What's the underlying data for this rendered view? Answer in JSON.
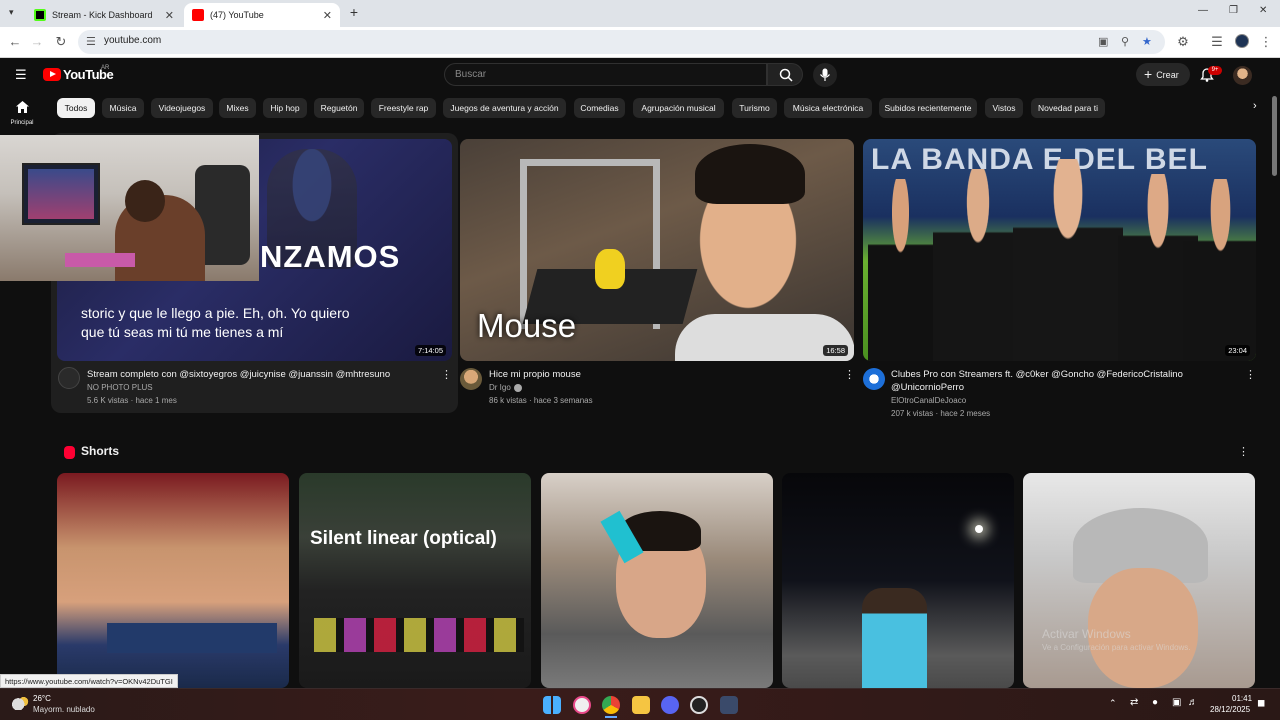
{
  "browser": {
    "tabs": [
      {
        "title": "Stream - Kick Dashboard",
        "active": false,
        "favicon_color": "#53fc18"
      },
      {
        "title": "(47) YouTube",
        "active": true,
        "favicon_color": "#ff0000"
      }
    ],
    "new_tab": "+",
    "url": "youtube.com"
  },
  "yt": {
    "logo_text": "YouTube",
    "country": "AR",
    "search_placeholder": "Buscar",
    "create_label": "Crear",
    "notif_count": "9+",
    "home_label": "Principal",
    "chips": [
      "Todos",
      "Música",
      "Videojuegos",
      "Mixes",
      "Hip hop",
      "Reguetón",
      "Freestyle rap",
      "Juegos de aventura y acción",
      "Comedias",
      "Agrupación musical",
      "Turismo",
      "Música electrónica",
      "Subidos recientemente",
      "Vistos",
      "Novedad para ti"
    ],
    "videos": [
      {
        "title": "Stream completo con @sixtoyegros @juicynise @juanssin @mhtresuno",
        "channel": "NO PHOTO PLUS",
        "meta": "5.6 K vistas · hace 1 mes",
        "duration": "7:14:05",
        "overlay_big": "NZAMOS",
        "overlay_caption": "storic y que le llego a pie. Eh, oh. Yo quiero que tú seas mi tú me tienes a mí"
      },
      {
        "title": "Hice mi propio mouse",
        "channel": "Dr Igo",
        "meta": "86 k vistas · hace 3 semanas",
        "duration": "16:58",
        "overlay_big": "Mouse"
      },
      {
        "title": "Clubes Pro con Streamers ft. @c0ker @Goncho @FedericoCristalino @UnicornioPerro",
        "channel": "ElOtroCanalDeJoaco",
        "meta": "207 k vistas · hace 2 meses",
        "duration": "23:04",
        "overlay_big": "LA BANDA E DEL BEL"
      }
    ],
    "shorts_title": "Shorts",
    "shorts_overlay": "Silent linear (optical)",
    "status_url": "https://www.youtube.com/watch?v=OKNv42DuTGI",
    "watermark_title": "Activar Windows",
    "watermark_sub": "Ve a Configuración para activar Windows."
  },
  "taskbar": {
    "weather_temp": "26°C",
    "weather_desc": "Mayorm. nublado",
    "time": "01:41",
    "date": "28/12/2025"
  }
}
